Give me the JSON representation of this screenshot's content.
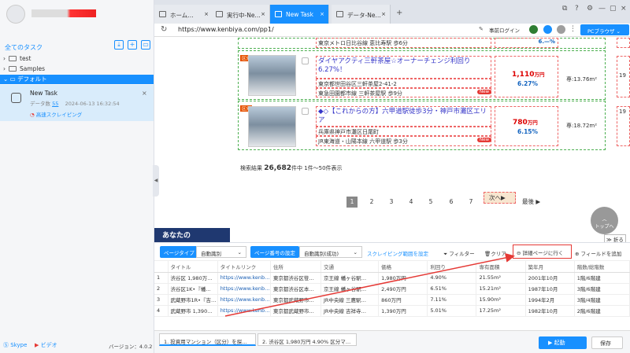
{
  "left_panel": {
    "all_tasks": "全てのタスク",
    "folders": [
      "test",
      "Samples",
      "デフォルト"
    ],
    "task": {
      "name": "New Task",
      "meta_label": "データ数",
      "meta_count": "55",
      "meta_date": "2024-06-13 16:32:54",
      "mode": "高速スクレイピング"
    },
    "skype": "Skype",
    "video": "ビデオ",
    "version": "バージョン：4.0.2"
  },
  "tabs": [
    {
      "label": "ホーム…"
    },
    {
      "label": "実行中-Ne…"
    },
    {
      "label": "New Task"
    },
    {
      "label": "データ-Ne…"
    }
  ],
  "address": {
    "url": "https://www.kenbiya.com/pp1/",
    "pre_login": "事前ログイン",
    "pc_browser": "PCブラウザ"
  },
  "web": {
    "top_line": "東京メトロ日比谷線 恵比寿駅 歩6分",
    "listings": [
      {
        "badge": "区分",
        "title": "ダイヤアクティ三軒茶屋☆オーナーチェンジ利回り6.27%！",
        "address": "東京都世田谷区三軒茶屋2-41-2",
        "station": "東急田園都市線 三軒茶屋駅 歩9分",
        "price_num": "1,110",
        "price_unit": "万円",
        "yield": "6.27%",
        "area": "専:13.76m²",
        "right_col": "19"
      },
      {
        "badge": "区分",
        "title": "◆◇【これからの方】六甲道駅徒歩3分・神戸市灘区エリア",
        "address": "兵庫県神戸市灘区日尾町",
        "station": "JR東海道・山陽本線 六甲道駅 歩3分",
        "price_num": "780",
        "price_unit": "万円",
        "yield": "6.15%",
        "area": "専:18.72m²",
        "right_col": "19"
      }
    ],
    "new_label": "New",
    "result_prefix": "検索結果",
    "result_count": "26,682",
    "result_suffix": "件中  1件～50件表示",
    "pages": [
      "1",
      "2",
      "3",
      "4",
      "5",
      "6",
      "7"
    ],
    "next": "次へ▶",
    "last": "最後",
    "to_top": "トップへ",
    "anata": "あなたの",
    "fold": "折る"
  },
  "toolbar": {
    "page_type_label": "ページタイプ",
    "page_type_value": "自動識別",
    "page_num_label": "ページ番号の設定",
    "page_num_value": "自動識別(成功)",
    "scroll_range": "スクレイピング範囲を設定",
    "filter": "フィルター",
    "clear": "クリア",
    "detail": "詳細ページに行く",
    "add_field": "フィールドを追加"
  },
  "table": {
    "headers": [
      "",
      "タイトル",
      "タイトルリンク",
      "住所",
      "交通",
      "価格",
      "利回り",
      "専有面積",
      "築年月",
      "階数/総階数"
    ],
    "rows": [
      [
        "1",
        "渋谷区 1,980万…",
        "https://www.kenb…",
        "東京都渋谷区笹…",
        "京王線 幡ヶ谷駅…",
        "1,980万円",
        "4.90%",
        "21.55m²",
        "2001年10月",
        "1階/6階建"
      ],
      [
        "2",
        "渋谷区1K•『幡…",
        "https://www.kenb…",
        "東京都渋谷区本…",
        "京王線 幡ヶ谷駅…",
        "2,490万円",
        "6.51%",
        "15.21m²",
        "1987年10月",
        "3階/6階建"
      ],
      [
        "3",
        "武蔵野市1R•『吉…",
        "https://www.kenb…",
        "東京都武蔵野市…",
        "JR中央線 三鷹駅…",
        "860万円",
        "7.11%",
        "15.90m²",
        "1994年2月",
        "3階/4階建"
      ],
      [
        "4",
        "武蔵野市 1,390…",
        "https://www.kenb…",
        "東京都武蔵野市…",
        "JR中央線 吉祥寺…",
        "1,390万円",
        "5.01%",
        "17.25m²",
        "1982年10月",
        "2階/6階建"
      ]
    ]
  },
  "bottom": {
    "tab1": "1. 投資用マンション（区分）を探…",
    "tab2": "2. 渋谷区 1,980万円 4.90% 区分マ…",
    "start": "▶ 起動",
    "save": "保存"
  },
  "colors": {
    "accent": "#1890ff",
    "price": "#dd0000",
    "annotation": "#e53935"
  }
}
